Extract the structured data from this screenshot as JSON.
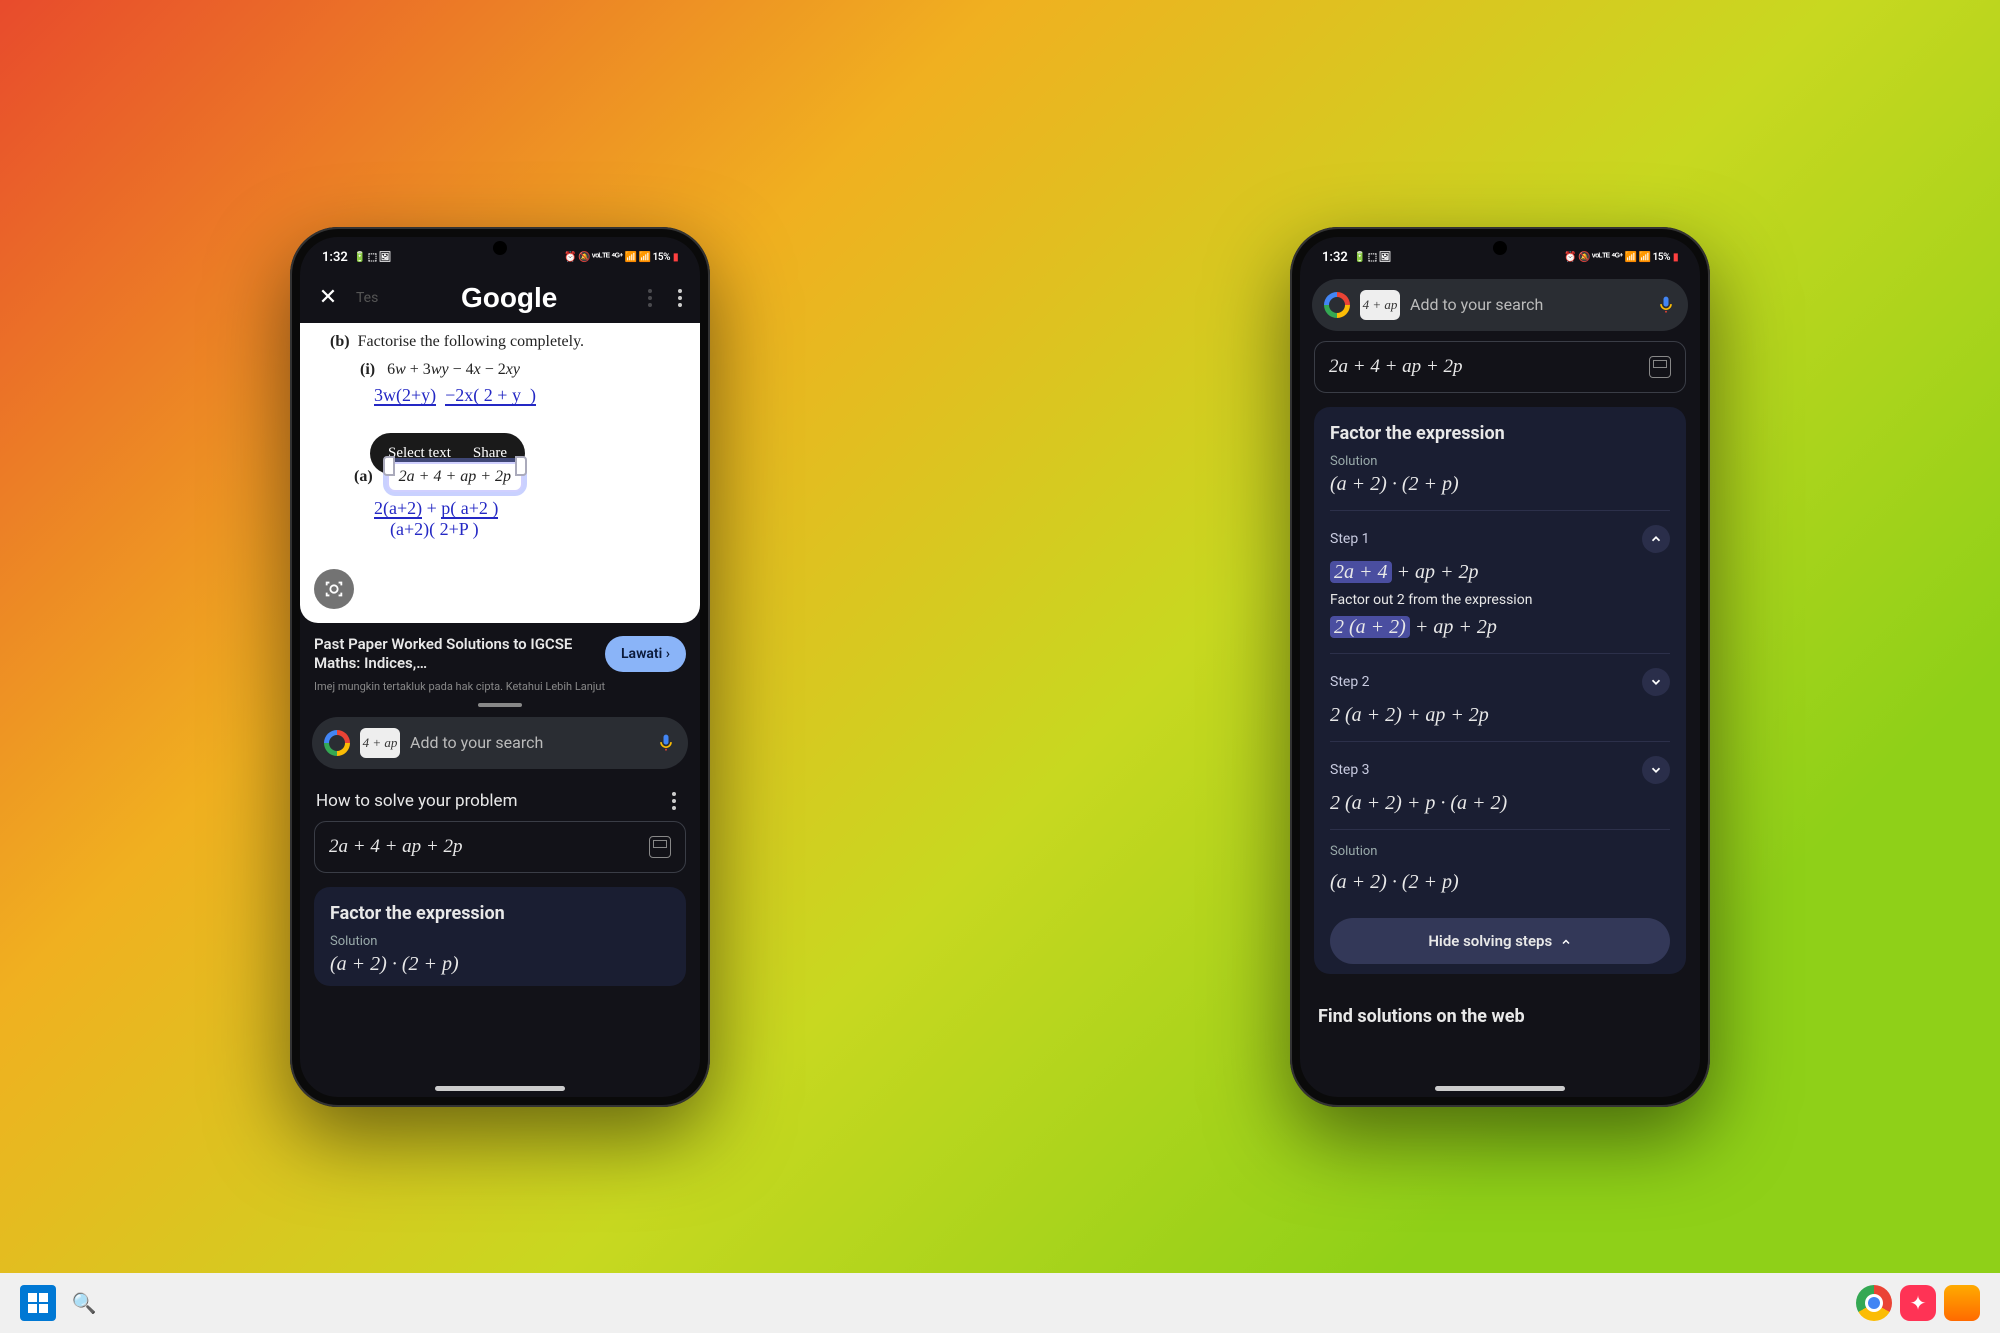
{
  "status": {
    "time": "1:32",
    "icons_left": "🔋 ⬚ 🖼",
    "icons_right": "⏰ 🔕 ᵛᵒᴸᵀᴱ ⁴ᴳ⁺ 📶 📶 15%",
    "battery_pct": "15%"
  },
  "left": {
    "header": {
      "tab_hint": "Tes",
      "title": "Google"
    },
    "worksheet": {
      "line_b": "(b)   Factorise the following completely.",
      "line_i": "(i)    6w + 3wy − 4x − 2xy",
      "pen1": "3w(2+y)  −2x( 2 + y   )",
      "actions": {
        "select": "Select text",
        "share": "Share"
      },
      "line_a": "(a)",
      "selected_expr": "2a + 4 + ap + 2p",
      "pen2": "2(a+2) + p( a+2 )",
      "pen3": "(a+2)( 2+P )"
    },
    "result_card": {
      "title": "Past Paper Worked Solutions to IGCSE Maths: Indices,…",
      "visit": "Lawati",
      "disclaimer": "Imej mungkin tertakluk pada hak cipta. Ketahui Lebih Lanjut"
    },
    "search": {
      "chip": "4 + ap",
      "placeholder": "Add to your search"
    },
    "solve": {
      "heading": "How to solve your problem",
      "expr": "2a + 4 + ap + 2p"
    },
    "factor": {
      "title": "Factor the expression",
      "sol_label": "Solution",
      "sol": "(a + 2) · (2 + p)"
    }
  },
  "right": {
    "search": {
      "chip": "4 + ap",
      "placeholder": "Add to your search"
    },
    "expr": "2a + 4 + ap + 2p",
    "factor": {
      "title": "Factor the expression",
      "sol_label": "Solution",
      "sol": "(a + 2) · (2 + p)",
      "step1": {
        "label": "Step 1",
        "eq1_hl": "2a + 4",
        "eq1_rest": " + ap + 2p",
        "desc": "Factor out 2 from the expression",
        "eq2_hl": "2 (a + 2)",
        "eq2_rest": " + ap + 2p"
      },
      "step2": {
        "label": "Step 2",
        "eq": "2 (a + 2) + ap + 2p"
      },
      "step3": {
        "label": "Step 3",
        "eq": "2 (a + 2) + p · (a + 2)"
      },
      "final_label": "Solution",
      "final": "(a + 2) · (2 + p)",
      "hide": "Hide solving steps"
    },
    "web_heading": "Find solutions on the web"
  },
  "taskbar": {
    "chrome": "C",
    "search": "🔍"
  }
}
